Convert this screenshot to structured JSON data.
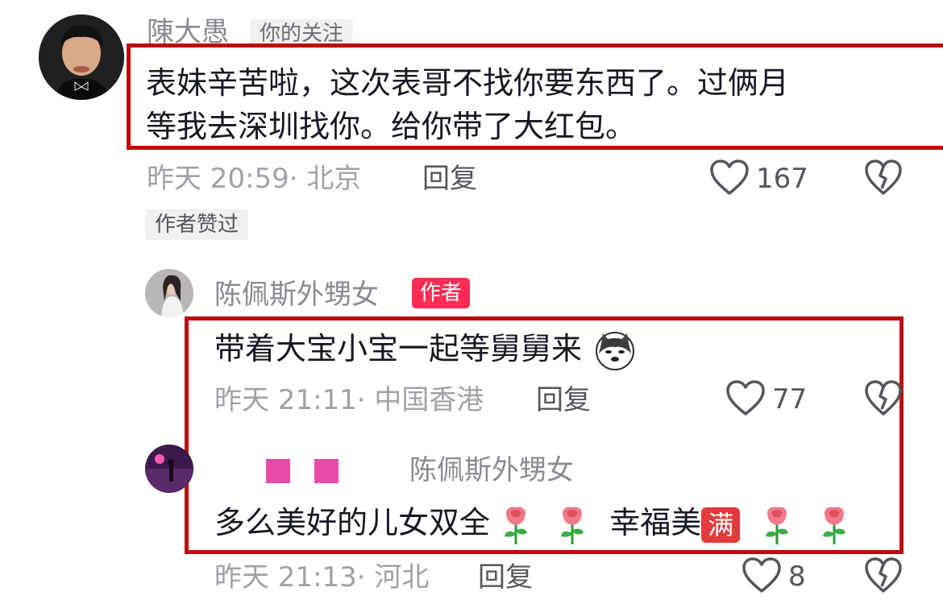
{
  "comments": [
    {
      "user": "陳大愚",
      "badge": "你的关注",
      "text_line1": "表妹辛苦啦，这次表哥不找你要东西了。过俩月",
      "text_line2": "等我去深圳找你。给你带了大红包。",
      "time_location": "昨天 20:59· 北京",
      "reply_label": "回复",
      "likes": "167",
      "liked_tag": "作者赞过"
    }
  ],
  "replies": [
    {
      "user": "陈佩斯外甥女",
      "badge": "作者",
      "text": "带着大宝小宝一起等舅舅来",
      "time_location": "昨天 21:11· 中国香港",
      "reply_label": "回复",
      "likes": "77"
    },
    {
      "reply_to": "陈佩斯外甥女",
      "text_part1": "多么美好的儿女双全",
      "text_part2": "幸福美",
      "full_badge": "满",
      "time_location": "昨天 21:13· 河北",
      "reply_label": "回复",
      "likes": "8"
    }
  ],
  "icons": {
    "like": "heart-outline-icon",
    "dislike": "broken-heart-icon",
    "emoji_dog": "dog-emoji",
    "emoji_rose": "rose-emoji"
  },
  "colors": {
    "highlight_box": "#c00a0a",
    "author_badge": "#fe2c55",
    "censor_block": "#e94aa8"
  }
}
